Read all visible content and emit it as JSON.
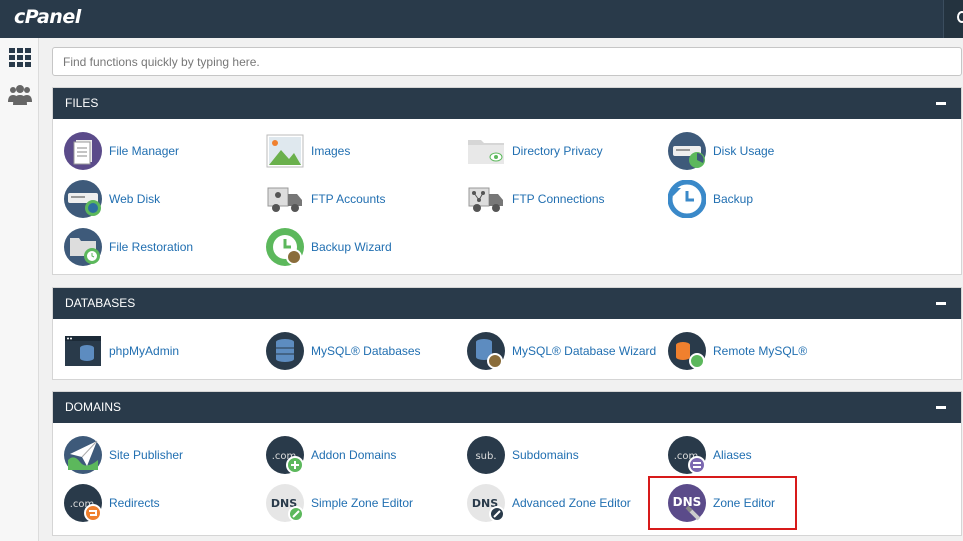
{
  "app": {
    "logo": "cPanel"
  },
  "search": {
    "placeholder": "Find functions quickly by typing here."
  },
  "sidebar": {
    "items": [
      {
        "icon": "grid-icon"
      },
      {
        "icon": "users-icon"
      }
    ]
  },
  "sections": {
    "files": {
      "title": "FILES",
      "items": [
        {
          "label": "File Manager",
          "icon": "file-manager-icon"
        },
        {
          "label": "Images",
          "icon": "images-icon"
        },
        {
          "label": "Directory Privacy",
          "icon": "directory-privacy-icon"
        },
        {
          "label": "Disk Usage",
          "icon": "disk-usage-icon"
        },
        {
          "label": "Web Disk",
          "icon": "web-disk-icon"
        },
        {
          "label": "FTP Accounts",
          "icon": "ftp-accounts-icon"
        },
        {
          "label": "FTP Connections",
          "icon": "ftp-connections-icon"
        },
        {
          "label": "Backup",
          "icon": "backup-icon"
        },
        {
          "label": "File Restoration",
          "icon": "file-restoration-icon"
        },
        {
          "label": "Backup Wizard",
          "icon": "backup-wizard-icon"
        }
      ]
    },
    "databases": {
      "title": "DATABASES",
      "items": [
        {
          "label": "phpMyAdmin",
          "icon": "phpmyadmin-icon"
        },
        {
          "label": "MySQL® Databases",
          "icon": "mysql-databases-icon"
        },
        {
          "label": "MySQL® Database Wizard",
          "icon": "mysql-wizard-icon"
        },
        {
          "label": "Remote MySQL®",
          "icon": "remote-mysql-icon"
        }
      ]
    },
    "domains": {
      "title": "DOMAINS",
      "items": [
        {
          "label": "Site Publisher",
          "icon": "site-publisher-icon"
        },
        {
          "label": "Addon Domains",
          "icon": "addon-domains-icon",
          "icon_text": ".com"
        },
        {
          "label": "Subdomains",
          "icon": "subdomains-icon",
          "icon_text": "sub."
        },
        {
          "label": "Aliases",
          "icon": "aliases-icon",
          "icon_text": ".com"
        },
        {
          "label": "Redirects",
          "icon": "redirects-icon",
          "icon_text": ".com"
        },
        {
          "label": "Simple Zone Editor",
          "icon": "simple-zone-editor-icon",
          "icon_text": "DNS"
        },
        {
          "label": "Advanced Zone Editor",
          "icon": "advanced-zone-editor-icon",
          "icon_text": "DNS"
        },
        {
          "label": "Zone Editor",
          "icon": "zone-editor-icon",
          "icon_text": "DNS"
        }
      ]
    }
  },
  "colors": {
    "header": "#293a4a",
    "link": "#216fb1",
    "accent_purple": "#5b4b8a",
    "accent_green": "#5cb85c",
    "accent_orange": "#f0802e",
    "highlight": "#d71a1a"
  }
}
